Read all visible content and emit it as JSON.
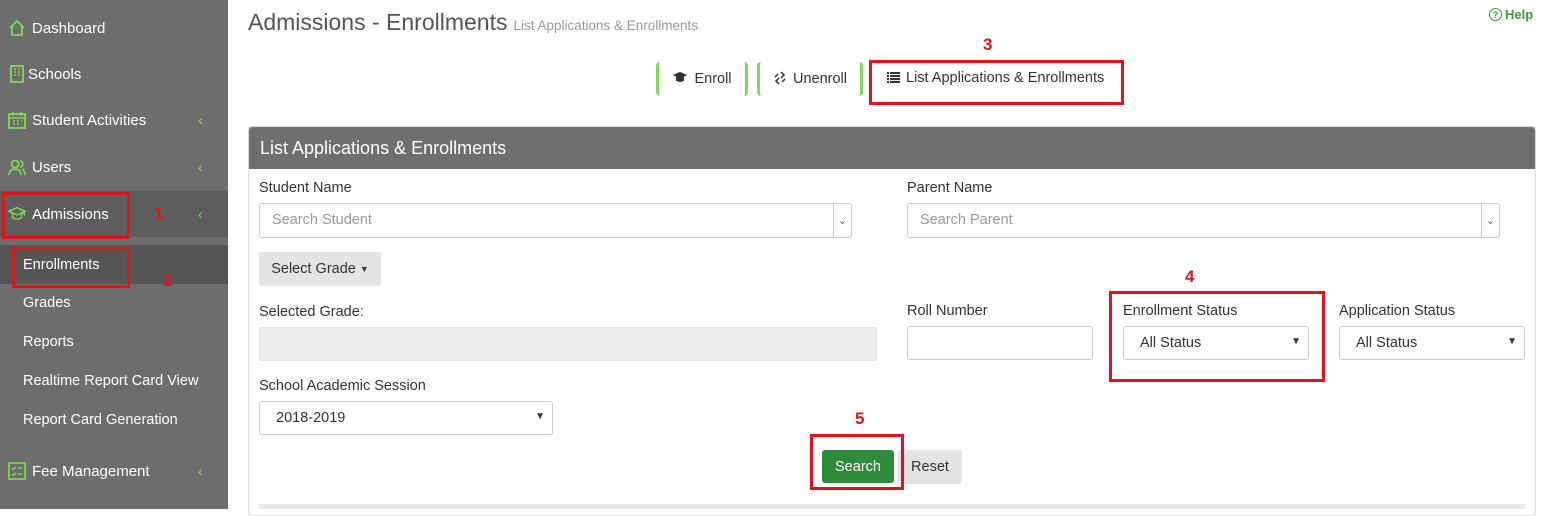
{
  "sidebar": {
    "items": [
      {
        "label": "Dashboard",
        "icon": "home-icon",
        "chevron": ""
      },
      {
        "label": "Schools",
        "icon": "building-icon",
        "chevron": ""
      },
      {
        "label": "Student Activities",
        "icon": "calendar-icon",
        "chevron": "‹"
      },
      {
        "label": "Users",
        "icon": "users-icon",
        "chevron": "‹"
      },
      {
        "label": "Admissions",
        "icon": "graduation-cap-icon",
        "chevron": "‹"
      },
      {
        "label": "Fee Management",
        "icon": "list-check-icon",
        "chevron": "‹"
      }
    ],
    "submenu": [
      "Enrollments",
      "Grades",
      "Reports",
      "Realtime Report Card View",
      "Report Card Generation"
    ]
  },
  "header": {
    "title": "Admissions - Enrollments",
    "subtitle": "List Applications & Enrollments",
    "help": "Help"
  },
  "tabs": [
    {
      "label": "Enroll",
      "icon": "graduation-cap-icon"
    },
    {
      "label": "Unenroll",
      "icon": "unlink-icon"
    },
    {
      "label": "List Applications & Enrollments",
      "icon": "list-icon"
    }
  ],
  "panel": {
    "title": "List Applications & Enrollments",
    "student_name_label": "Student Name",
    "student_placeholder": "Search Student",
    "parent_name_label": "Parent Name",
    "parent_placeholder": "Search Parent",
    "select_grade": "Select Grade",
    "selected_grade_label": "Selected Grade:",
    "roll_number_label": "Roll Number",
    "enrollment_status_label": "Enrollment Status",
    "enrollment_status_value": "All Status",
    "application_status_label": "Application Status",
    "application_status_value": "All Status",
    "session_label": "School Academic Session",
    "session_value": "2018-2019",
    "search": "Search",
    "reset": "Reset"
  },
  "annotations": [
    "1",
    "2",
    "3",
    "4",
    "5"
  ],
  "colors": {
    "accent_green": "#7ed957",
    "search_green": "#2e8b3a",
    "annotation_red": "#e0141c",
    "sidebar": "#6d6d6d"
  }
}
